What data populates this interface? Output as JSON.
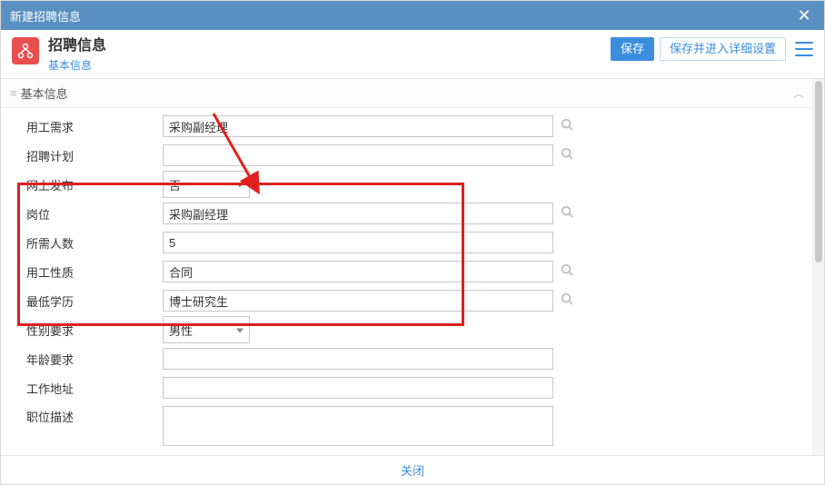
{
  "window": {
    "title": "新建招聘信息"
  },
  "header": {
    "page_title": "招聘信息",
    "tab": "基本信息",
    "save": "保存",
    "save_detail": "保存并进入详细设置"
  },
  "section": {
    "title": "基本信息"
  },
  "fields": {
    "labor_demand": {
      "label": "用工需求",
      "value": "采购副经理"
    },
    "hiring_plan": {
      "label": "招聘计划",
      "value": ""
    },
    "online_publish": {
      "label": "网上发布",
      "value": "否"
    },
    "position": {
      "label": "岗位",
      "value": "采购副经理"
    },
    "headcount": {
      "label": "所需人数",
      "value": "5"
    },
    "labor_type": {
      "label": "用工性质",
      "value": "合同"
    },
    "min_education": {
      "label": "最低学历",
      "value": "博士研究生"
    },
    "gender_req": {
      "label": "性别要求",
      "value": "男性"
    },
    "age_req": {
      "label": "年龄要求",
      "value": ""
    },
    "work_address": {
      "label": "工作地址",
      "value": ""
    },
    "job_desc": {
      "label": "职位描述",
      "value": ""
    }
  },
  "footer": {
    "close": "关闭"
  }
}
